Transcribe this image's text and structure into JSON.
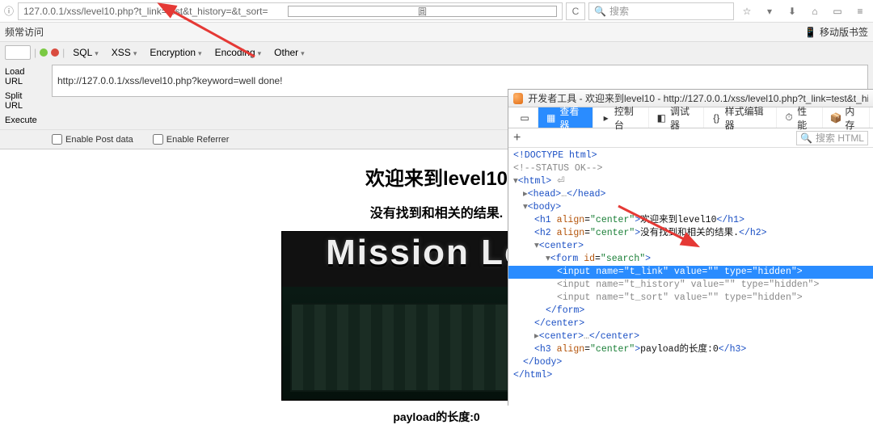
{
  "address": {
    "url": "127.0.0.1/xss/level10.php?t_link=test&t_history=&t_sort="
  },
  "search": {
    "placeholder": "搜索"
  },
  "toolbar_icons": {
    "reader": "阅",
    "refresh": "⟳",
    "star": "☆",
    "bookmark_mobile": "移动版书签"
  },
  "bookmarks": {
    "left": "频常访问"
  },
  "hackbar": {
    "menus": {
      "sql": "SQL",
      "xss": "XSS",
      "encryption": "Encryption",
      "encoding": "Encoding",
      "other": "Other"
    },
    "left": {
      "load": "Load URL",
      "split": "Split URL",
      "execute": "Execute"
    },
    "url_value": "http://127.0.0.1/xss/level10.php?keyword=well done!",
    "opts": {
      "post": "Enable Post data",
      "referrer": "Enable Referrer"
    }
  },
  "page": {
    "h1": "欢迎来到level10",
    "h2": "没有找到和相关的结果.",
    "mission": "Mission Lev",
    "payload": "payload的长度:0"
  },
  "devtools": {
    "title": "开发者工具 - 欢迎来到level10 - http://127.0.0.1/xss/level10.php?t_link=test&t_history=&t_s",
    "tabs": {
      "inspector": "查看器",
      "console": "控制台",
      "debugger": "调试器",
      "style": "样式编辑器",
      "perf": "性能",
      "memory": "内存"
    },
    "search_placeholder": "搜索 HTML",
    "lines": {
      "doctype": "<!DOCTYPE html>",
      "status": "<!--STATUS OK-->",
      "html_open": "<html>",
      "head": "<head>…</head>",
      "body_open": "<body>",
      "h1_open": "<h1 align=\"center\">",
      "h1_text": "欢迎来到level10",
      "h1_close": "</h1>",
      "h2_open": "<h2 align=\"center\">",
      "h2_text": "没有找到和相关的结果.",
      "h2_close": "</h2>",
      "center_open": "<center>",
      "form_open": "<form id=\"search\">",
      "input1": "<input name=\"t_link\" value=\"\" type=\"hidden\">",
      "input2": "<input name=\"t_history\" value=\"\" type=\"hidden\">",
      "input3": "<input name=\"t_sort\" value=\"\" type=\"hidden\">",
      "form_close": "</form>",
      "center_close": "</center>",
      "center2": "<center>…</center>",
      "h3_open": "<h3 align=\"center\">",
      "h3_text": "payload的长度:0",
      "h3_close": "</h3>",
      "body_close": "</body>",
      "html_close": "</html>"
    }
  }
}
